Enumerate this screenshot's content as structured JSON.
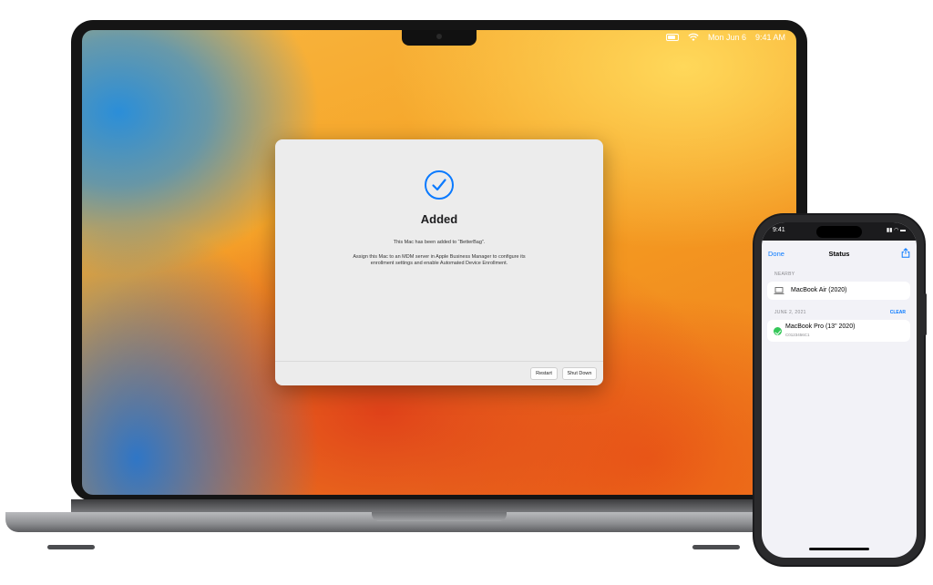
{
  "mac": {
    "menubar": {
      "date": "Mon Jun 6",
      "time": "9:41 AM",
      "icons": [
        "battery-icon",
        "wifi-icon"
      ]
    },
    "dialog": {
      "icon": "checkmark-circle-icon",
      "title": "Added",
      "message": "This Mac has been added to “BetterBag”.",
      "detail": "Assign this Mac to an MDM server in Apple Business Manager to configure its enrollment settings and enable Automated Device Enrollment.",
      "buttons": {
        "restart": "Restart",
        "shutdown": "Shut Down"
      },
      "accent": "#0a7aff"
    }
  },
  "iphone": {
    "status_time": "9:41",
    "nav": {
      "done": "Done",
      "title": "Status",
      "share_icon": "share-icon"
    },
    "nearby": {
      "label": "NEARBY",
      "items": [
        {
          "name": "MacBook Air (2020)",
          "icon": "laptop-icon"
        }
      ]
    },
    "history": {
      "date_label": "JUNE 2, 2021",
      "clear": "CLEAR",
      "items": [
        {
          "name": "MacBook Pro (13\" 2020)",
          "serial": "C0123456C1",
          "icon": "checkmark-icon",
          "status_color": "#34c759"
        }
      ]
    }
  }
}
